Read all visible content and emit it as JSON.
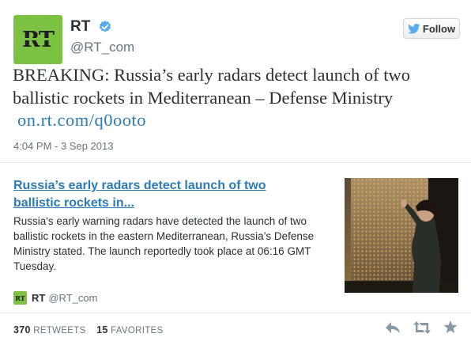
{
  "account": {
    "display_name": "RT",
    "handle": "@RT_com",
    "avatar_text": "RT",
    "brand_color": "#7cc242",
    "verified_color": "#55acee"
  },
  "follow_button": {
    "label": "Follow",
    "icon": "twitter-bird-icon"
  },
  "tweet": {
    "text": "BREAKING: Russia’s early radars detect launch of two ballistic rockets in Mediterranean – Defense Ministry",
    "link": "on.rt.com/q0ooto",
    "timestamp": "4:04 PM - 3 Sep 2013"
  },
  "card": {
    "title": "Russia’s early radars detect launch of two ballistic rockets in...",
    "description": "Russia's early warning radars have detected the launch of two ballistic rockets in the eastern Mediterranean, Russia’s Defense Ministry stated. The launch reportedly took place at 06:16 GMT Tuesday.",
    "source_logo_text": "RT",
    "source_name": "RT",
    "source_handle": "@RT_com"
  },
  "stats": {
    "retweets_count": "370",
    "retweets_label": "RETWEETS",
    "favorites_count": "15",
    "favorites_label": "FAVORITES"
  },
  "actions": [
    "reply-icon",
    "retweet-icon",
    "favorite-icon"
  ],
  "colors": {
    "link": "#2b7bb9",
    "muted": "#66757f",
    "action_icon": "#8899a6"
  }
}
